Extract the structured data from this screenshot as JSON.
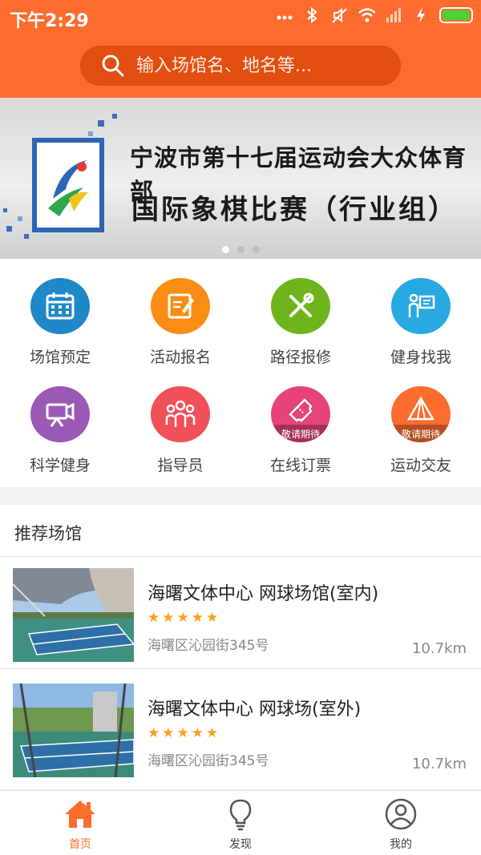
{
  "status": {
    "time": "下午2:29"
  },
  "search": {
    "placeholder": "输入场馆名、地名等..."
  },
  "banner": {
    "line1": "宁波市第十七届运动会大众体育部",
    "line2": "国际象棋比赛（行业组）",
    "slides": 3,
    "active_slide": 0
  },
  "grid": {
    "items": [
      {
        "label": "场馆预定",
        "icon": "calendar-icon",
        "color": "#1e88c8"
      },
      {
        "label": "活动报名",
        "icon": "edit-icon",
        "color": "#fb8c14"
      },
      {
        "label": "路径报修",
        "icon": "tools-icon",
        "color": "#6fb41c"
      },
      {
        "label": "健身找我",
        "icon": "coach-icon",
        "color": "#29a9e1"
      },
      {
        "label": "科学健身",
        "icon": "projector-icon",
        "color": "#9b59b6"
      },
      {
        "label": "指导员",
        "icon": "group-icon",
        "color": "#f0505a"
      },
      {
        "label": "在线订票",
        "icon": "ticket-icon",
        "color": "#e5437a",
        "badge": "敬请期待"
      },
      {
        "label": "运动交友",
        "icon": "tent-icon",
        "color": "#fb6c2e",
        "badge": "敬请期待"
      }
    ]
  },
  "recommend": {
    "title": "推荐场馆",
    "venues": [
      {
        "name": "海曙文体中心 网球场馆(室内)",
        "rating": 5,
        "address": "海曙区沁园街345号",
        "distance": "10.7km"
      },
      {
        "name": "海曙文体中心 网球场(室外)",
        "rating": 5,
        "address": "海曙区沁园街345号",
        "distance": "10.7km"
      }
    ]
  },
  "nav": {
    "items": [
      {
        "label": "首页",
        "icon": "home-icon",
        "active": true
      },
      {
        "label": "发现",
        "icon": "bulb-icon",
        "active": false
      },
      {
        "label": "我的",
        "icon": "user-icon",
        "active": false
      }
    ]
  },
  "colors": {
    "brand": "#fb6c2e",
    "star": "#f7a11c"
  }
}
